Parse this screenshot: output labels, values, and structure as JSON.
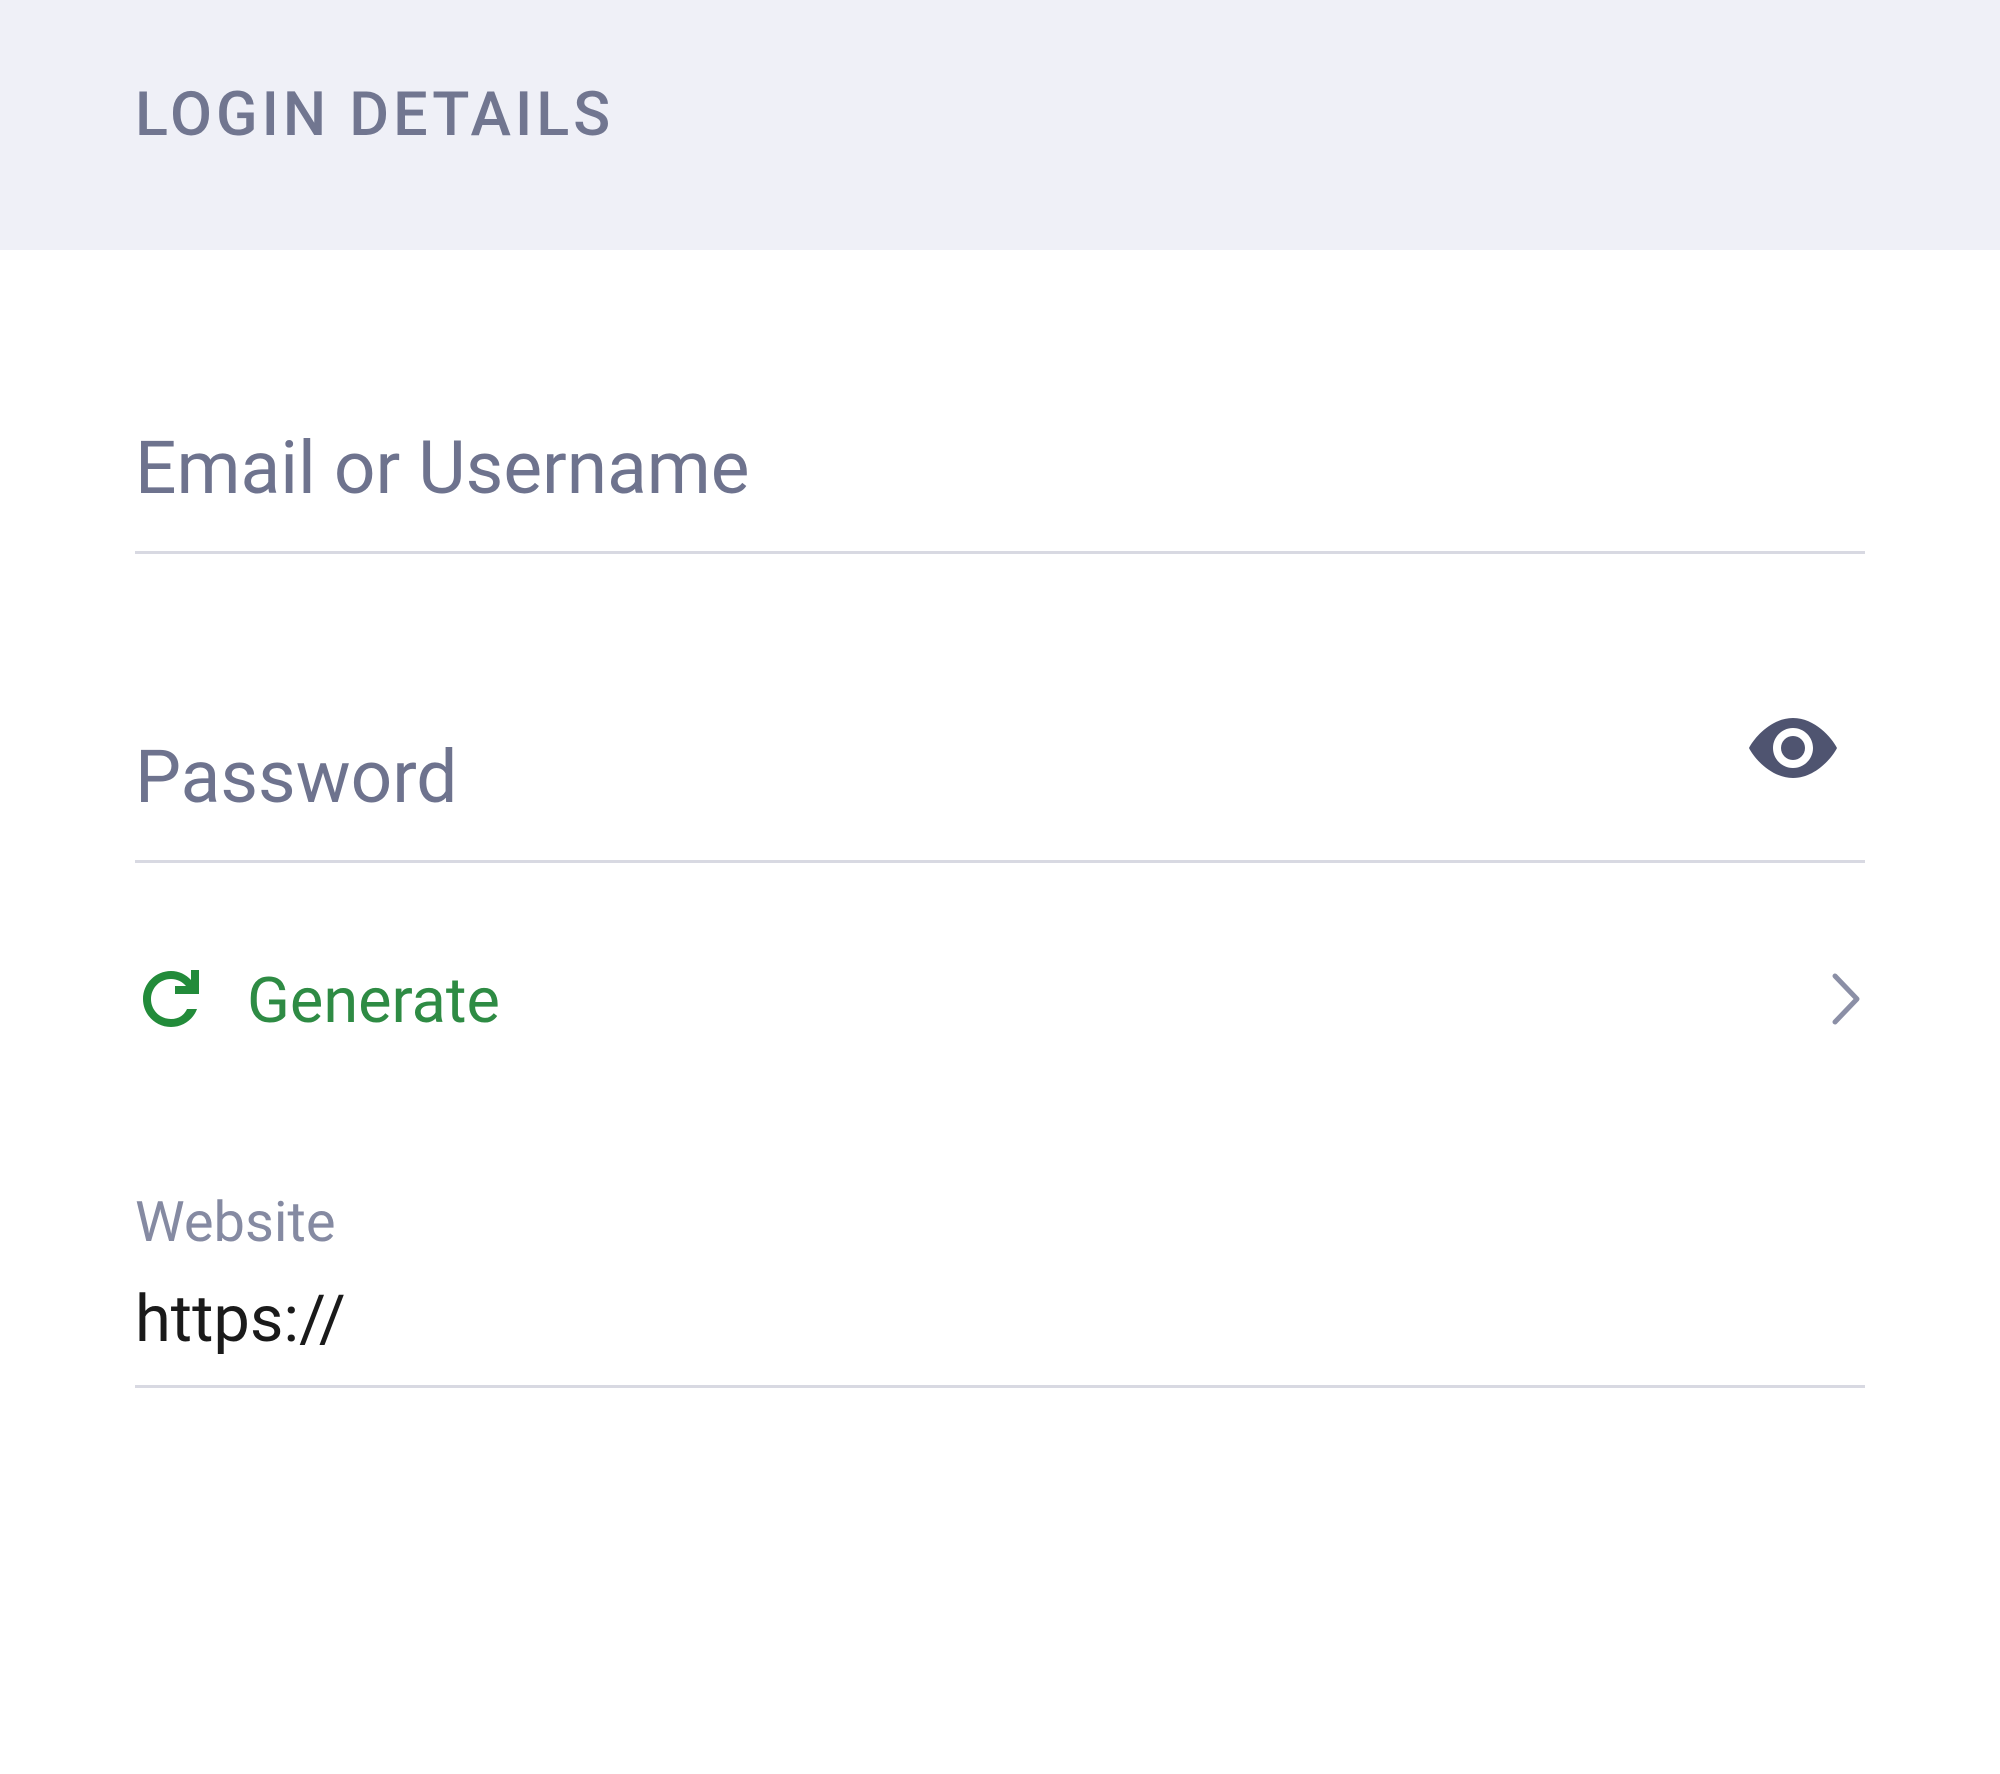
{
  "header": {
    "title": "LOGIN DETAILS"
  },
  "fields": {
    "username": {
      "placeholder": "Email or Username",
      "value": ""
    },
    "password": {
      "placeholder": "Password",
      "value": ""
    },
    "website": {
      "label": "Website",
      "value": "https://"
    }
  },
  "actions": {
    "generate": "Generate"
  },
  "icons": {
    "eye": "eye-icon",
    "refresh": "refresh-icon",
    "chevron": "chevron-right-icon"
  },
  "colors": {
    "accent_green": "#2e8b44",
    "muted_text": "#6e738e",
    "header_bg": "#eff0f7",
    "divider": "#d8d9e2"
  }
}
